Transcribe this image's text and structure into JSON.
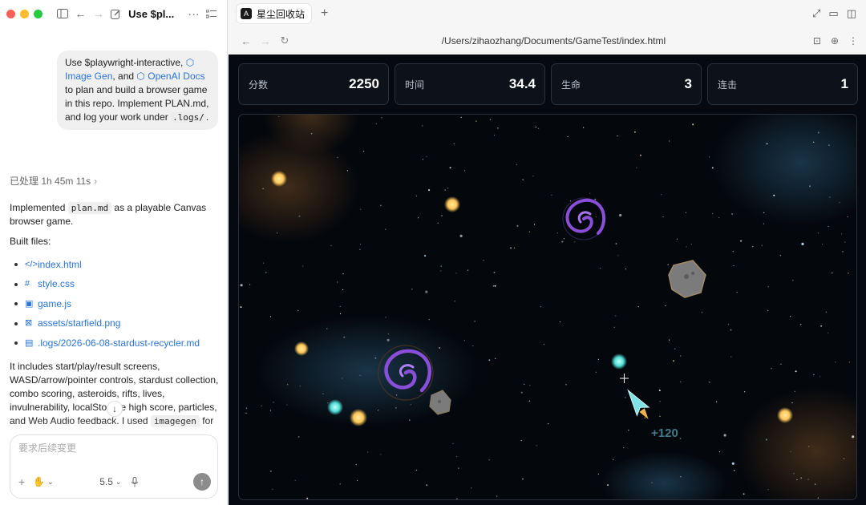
{
  "chat": {
    "thread_title": "Use $pl...",
    "user_message": {
      "line1_prefix": "Use $playwright-interactive,",
      "image_gen": "Image Gen",
      "and": ", and",
      "openai_docs": "OpenAI Docs",
      "line3": "to plan and build a browser game in this repo.",
      "line4": "Implement PLAN.md, and log your work under",
      "logs_dir": ".logs/",
      "period": "."
    },
    "processed_label": "已处理 1h 45m 11s",
    "response": {
      "p1_a": "Implemented",
      "p1_code": "plan.md",
      "p1_b": "as a playable Canvas browser game.",
      "built_files_label": "Built files:",
      "files": [
        {
          "icon": "</>",
          "name": "index.html"
        },
        {
          "icon": "#",
          "name": "style.css"
        },
        {
          "icon": "▣",
          "name": "game.js"
        },
        {
          "icon": "⊠",
          "name": "assets/starfield.png"
        },
        {
          "icon": "▤",
          "name": ".logs/2026-06-08-stardust-recycler.md"
        }
      ],
      "p2_a": "It includes start/play/result screens, WASD/arrow/pointer controls, stardust collection, combo scoring, asteroids, rifts, lives, invulnerability, localStorage high score, particles, and Web Audio feedback. I used",
      "p2_code": "imagegen",
      "p2_b": "for"
    },
    "composer": {
      "placeholder": "要求后续变更",
      "model": "5.5"
    }
  },
  "browser": {
    "tab_title": "星尘回收站",
    "url": "/Users/zihaozhang/Documents/GameTest/index.html"
  },
  "game": {
    "stats": [
      {
        "label": "分数",
        "value": "2250"
      },
      {
        "label": "时间",
        "value": "34.4"
      },
      {
        "label": "生命",
        "value": "3"
      },
      {
        "label": "连击",
        "value": "1"
      }
    ],
    "score_popup": "+120"
  },
  "colors": {
    "accent_link": "#2a74d6",
    "stardust": "#ffc857",
    "orb": "#4fe0d8",
    "rift": "#8a4fd8",
    "ship": "#7fe3e6",
    "thrust": "#f0b24a"
  }
}
